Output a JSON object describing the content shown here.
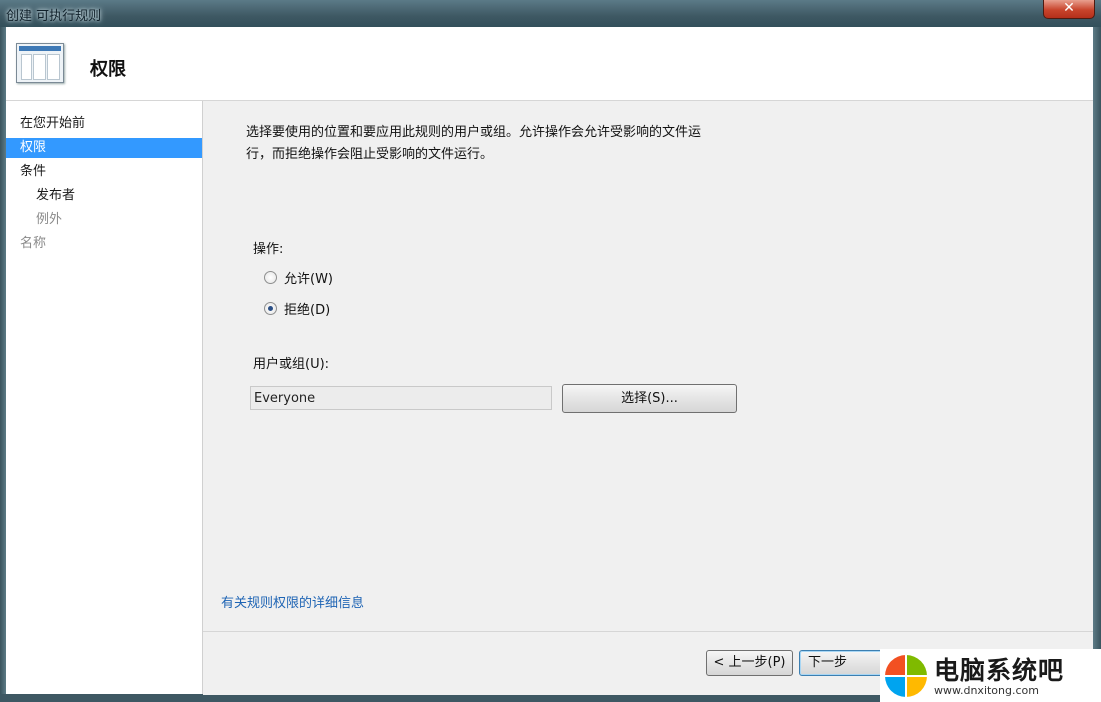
{
  "window": {
    "title": "创建 可执行规则",
    "close_glyph": "✕"
  },
  "header": {
    "title": "权限",
    "icon": "wizard-page-icon"
  },
  "nav": {
    "items": [
      {
        "label": "在您开始前",
        "state": "normal"
      },
      {
        "label": "权限",
        "state": "active"
      },
      {
        "label": "条件",
        "state": "normal"
      },
      {
        "label": "发布者",
        "state": "normal"
      },
      {
        "label": "例外",
        "state": "disabled"
      },
      {
        "label": "名称",
        "state": "disabled"
      }
    ],
    "active_color": "#3399ff"
  },
  "content": {
    "description": "选择要使用的位置和要应用此规则的用户或组。允许操作会允许受影响的文件运行，而拒绝操作会阻止受影响的文件运行。",
    "action_label": "操作:",
    "options": [
      {
        "label": "允许(W)",
        "checked": false
      },
      {
        "label": "拒绝(D)",
        "checked": true
      }
    ],
    "user_group_label": "用户或组(U):",
    "user_group_value": "Everyone",
    "select_button": "选择(S)...",
    "help_link": "有关规则权限的详细信息"
  },
  "footer": {
    "back_button": "< 上一步(P)",
    "next_button": "下一步"
  },
  "watermark": {
    "name": "电脑系统吧",
    "url": "www.dnxitong.com"
  }
}
